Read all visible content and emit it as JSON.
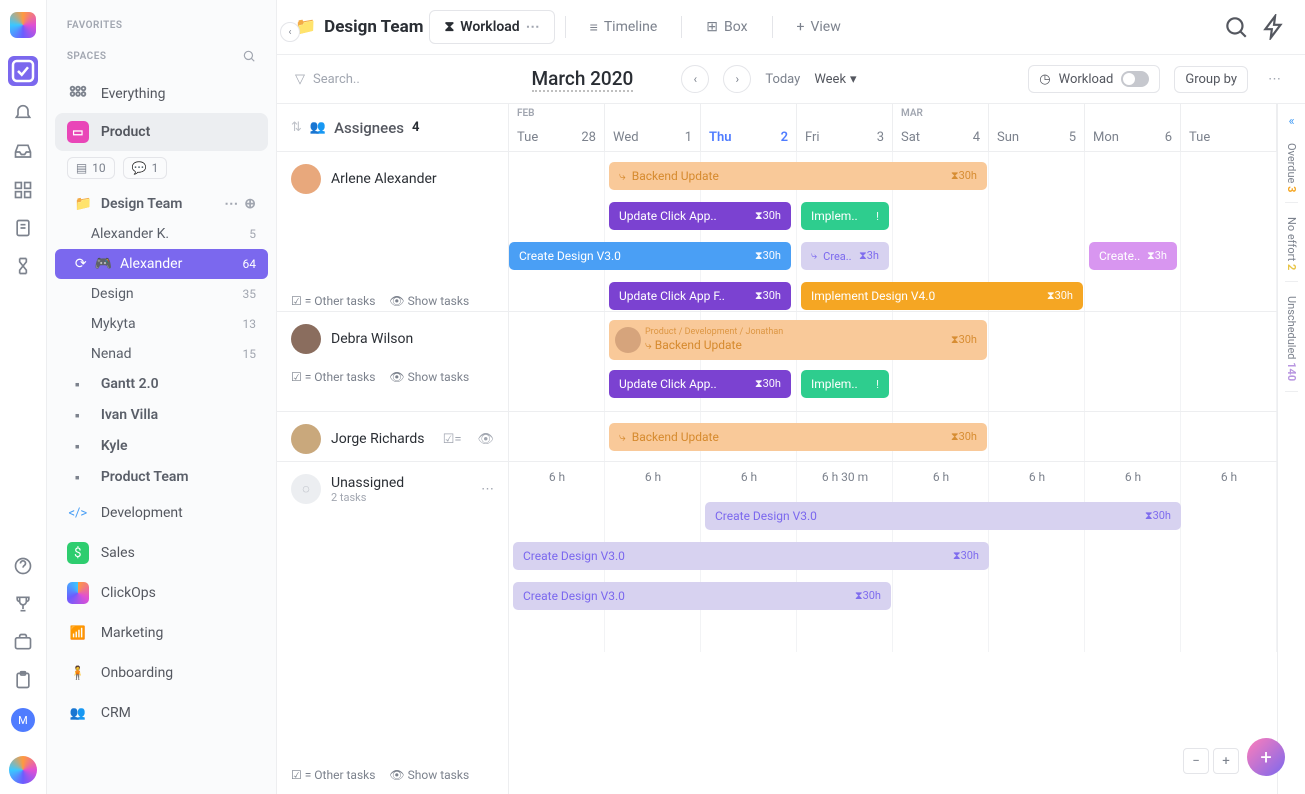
{
  "leftbar": {
    "avatar_letter": "M"
  },
  "sidebar": {
    "favorites_label": "FAVORITES",
    "spaces_label": "SPACES",
    "everything": "Everything",
    "product": "Product",
    "badge_docs": "10",
    "badge_chat": "1",
    "tree": {
      "design_team": "Design Team",
      "alexander_k": "Alexander K.",
      "alexander_k_count": "5",
      "alexander": "Alexander",
      "alexander_count": "64",
      "design": "Design",
      "design_count": "35",
      "mykyta": "Mykyta",
      "mykyta_count": "13",
      "nenad": "Nenad",
      "nenad_count": "15",
      "gantt": "Gantt 2.0",
      "ivan": "Ivan Villa",
      "kyle": "Kyle",
      "product_team": "Product Team"
    },
    "spaces": {
      "development": "Development",
      "sales": "Sales",
      "clickops": "ClickOps",
      "marketing": "Marketing",
      "onboarding": "Onboarding",
      "crm": "CRM"
    }
  },
  "topbar": {
    "breadcrumb": "Design Team",
    "tabs": {
      "workload": "Workload",
      "timeline": "Timeline",
      "box": "Box",
      "add_view": "View"
    }
  },
  "toolbar": {
    "search_placeholder": "Search..",
    "month": "March 2020",
    "today": "Today",
    "week": "Week",
    "workload_btn": "Workload",
    "group_by": "Group by"
  },
  "grid": {
    "assignees_label": "Assignees",
    "assignees_count": "4",
    "month_feb": "FEB",
    "month_mar": "MAR",
    "days": [
      {
        "name": "Tue",
        "num": "28"
      },
      {
        "name": "Wed",
        "num": "1"
      },
      {
        "name": "Thu",
        "num": "2",
        "active": true
      },
      {
        "name": "Fri",
        "num": "3"
      },
      {
        "name": "Sat",
        "num": "4"
      },
      {
        "name": "Sun",
        "num": "5"
      },
      {
        "name": "Mon",
        "num": "6"
      },
      {
        "name": "Tue",
        "num": ""
      }
    ],
    "people": {
      "arlene": "Arlene Alexander",
      "debra": "Debra Wilson",
      "jorge": "Jorge Richards",
      "unassigned": "Unassigned",
      "unassigned_sub": "2 tasks"
    },
    "other_tasks": "= Other tasks",
    "show_tasks": "Show tasks",
    "tasks": {
      "backend_update": "Backend Update",
      "update_click_short": "Update Click App..",
      "update_click_long": "Update Click App F..",
      "implement_short": "Implem..",
      "implement_long": "Implement Design V4.0",
      "create_design": "Create Design V3.0",
      "crea_short": "Crea..",
      "create_short": "Create..",
      "dur30": "30h",
      "dur3": "3h",
      "tooltip_path": "Product / Development / Jonathan"
    },
    "hours": [
      "6 h",
      "6 h",
      "6 h",
      "6 h 30 m",
      "6 h",
      "6 h",
      "6 h",
      "6 h"
    ]
  },
  "rightpanel": {
    "overdue_n": "3",
    "overdue": "Overdue",
    "noeffort_n": "2",
    "noeffort": "No effort",
    "unsched_n": "140",
    "unsched": "Unscheduled"
  }
}
